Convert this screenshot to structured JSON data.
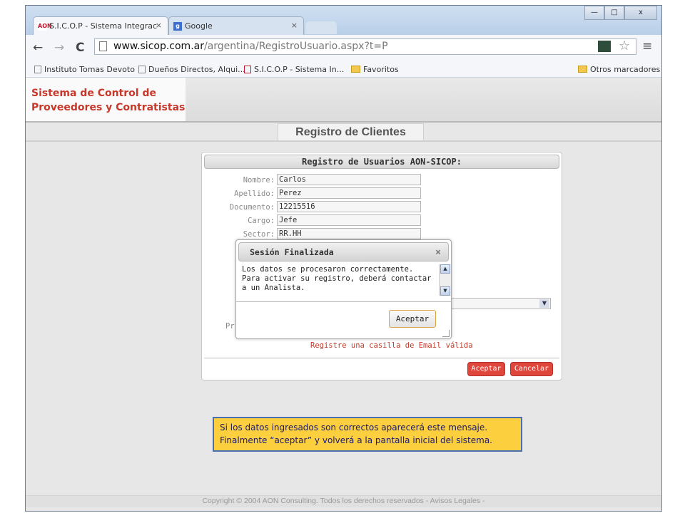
{
  "browser": {
    "tabs": [
      {
        "label": "S.I.C.O.P - Sistema Integrac",
        "icon": "aon-favicon",
        "close": "×"
      },
      {
        "label": "Google",
        "icon": "google-favicon",
        "close": "×"
      }
    ],
    "window_controls": {
      "minimize": "—",
      "maximize": "□",
      "close": "x"
    },
    "nav": {
      "back": "←",
      "forward": "→",
      "reload": "C"
    },
    "url": {
      "host": "www.sicop.com.ar",
      "path": "/argentina/RegistroUsuario.aspx?t=P"
    },
    "star": "☆",
    "menu": "≡",
    "bookmarks": [
      {
        "label": "Instituto Tomas Devoto",
        "icon": "page-icon"
      },
      {
        "label": "Dueños Directos, Alqui...",
        "icon": "page-icon"
      },
      {
        "label": "S.I.C.O.P - Sistema In...",
        "icon": "aon-favicon"
      },
      {
        "label": "Favoritos",
        "icon": "folder-icon"
      }
    ],
    "other_bookmarks": "Otros marcadores"
  },
  "site": {
    "logo_line1": "Sistema de Control de",
    "logo_line2": "Proveedores y Contratistas",
    "section_title": "Registro de Clientes"
  },
  "form": {
    "title": "Registro de Usuarios AON-SICOP:",
    "fields": [
      {
        "label": "Nombre:",
        "value": "Carlos"
      },
      {
        "label": "Apellido:",
        "value": "Perez"
      },
      {
        "label": "Documento:",
        "value": "12215516"
      },
      {
        "label": "Cargo:",
        "value": "Jefe"
      },
      {
        "label": "Sector:",
        "value": "RR.HH"
      }
    ],
    "partial_label": "Pr",
    "validation": "Registre una casilla de Email válida",
    "accept": "Aceptar",
    "cancel": "Cancelar"
  },
  "dialog": {
    "title": "Sesión Finalizada",
    "close": "×",
    "message": "Los datos se procesaron correctamente. Para activar su registro, deberá contactar a un Analista.",
    "button": "Aceptar"
  },
  "note": {
    "line1": "Si los datos ingresados son correctos aparecerá este mensaje.",
    "line2": "Finalmente  “aceptar” y volverá a la pantalla inicial del sistema."
  },
  "footer": "Copyright © 2004 AON Consulting. Todos los derechos reservados - Avisos Legales -",
  "colors": {
    "accent_red": "#c8382a",
    "button_red": "#e0473c",
    "note_yellow": "#fccf3f",
    "note_border": "#4a6fb1",
    "error_text": "#c0392b"
  }
}
